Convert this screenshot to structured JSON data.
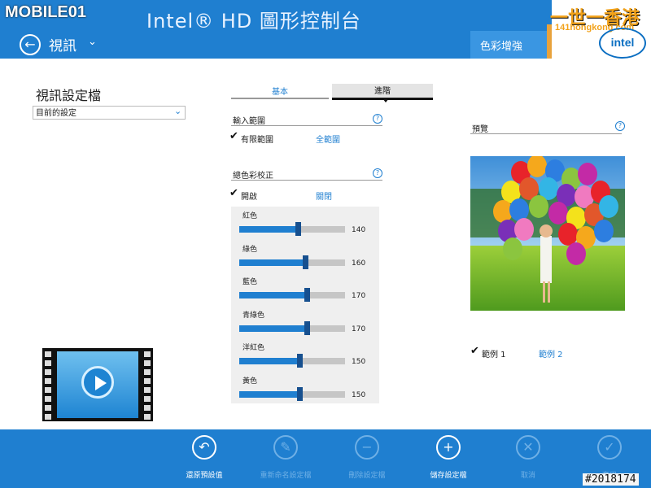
{
  "header": {
    "app_title": "Intel® HD 圖形控制台",
    "section_title": "視訊",
    "active_tab_label": "色彩增強",
    "intel_logo_text": "intel",
    "color_primary": "#1f7fd0"
  },
  "watermarks": {
    "left": "MOBILE01",
    "right_top": "一世一香港",
    "right_url": "141hongkong.com",
    "bottom_id": "#2018174"
  },
  "profile": {
    "heading": "視訊設定檔",
    "selected": "目前的設定"
  },
  "tabs": [
    {
      "label": "基本",
      "active": false
    },
    {
      "label": "進階",
      "active": true
    }
  ],
  "input_range": {
    "title": "輸入範圍",
    "options": [
      {
        "label": "有限範圍",
        "checked": true
      },
      {
        "label": "全範圍",
        "checked": false
      }
    ]
  },
  "color_correction": {
    "title": "總色彩校正",
    "options": [
      {
        "label": "開啟",
        "checked": true
      },
      {
        "label": "關閉",
        "checked": false
      }
    ],
    "sliders": [
      {
        "label": "紅色",
        "value": "140",
        "level": 0.55
      },
      {
        "label": "綠色",
        "value": "160",
        "level": 0.62
      },
      {
        "label": "藍色",
        "value": "170",
        "level": 0.64
      },
      {
        "label": "青綠色",
        "value": "170",
        "level": 0.64
      },
      {
        "label": "洋紅色",
        "value": "150",
        "level": 0.57
      },
      {
        "label": "黃色",
        "value": "150",
        "level": 0.57
      }
    ]
  },
  "preview": {
    "title": "預覽",
    "examples": [
      {
        "label": "範例 1",
        "checked": true
      },
      {
        "label": "範例 2",
        "checked": false
      }
    ]
  },
  "actions": [
    {
      "label": "還原預設值",
      "icon": "undo-icon",
      "glyph": "↶",
      "enabled": true
    },
    {
      "label": "重新命名設定檔",
      "icon": "pencil-icon",
      "glyph": "✎",
      "enabled": false
    },
    {
      "label": "刪除設定檔",
      "icon": "minus-icon",
      "glyph": "−",
      "enabled": false
    },
    {
      "label": "儲存設定檔",
      "icon": "plus-icon",
      "glyph": "+",
      "enabled": true
    },
    {
      "label": "取消",
      "icon": "close-icon",
      "glyph": "✕",
      "enabled": false
    },
    {
      "label": "套用",
      "icon": "check-icon",
      "glyph": "✓",
      "enabled": false
    }
  ],
  "help_glyph": "?",
  "check_glyph": "✔"
}
